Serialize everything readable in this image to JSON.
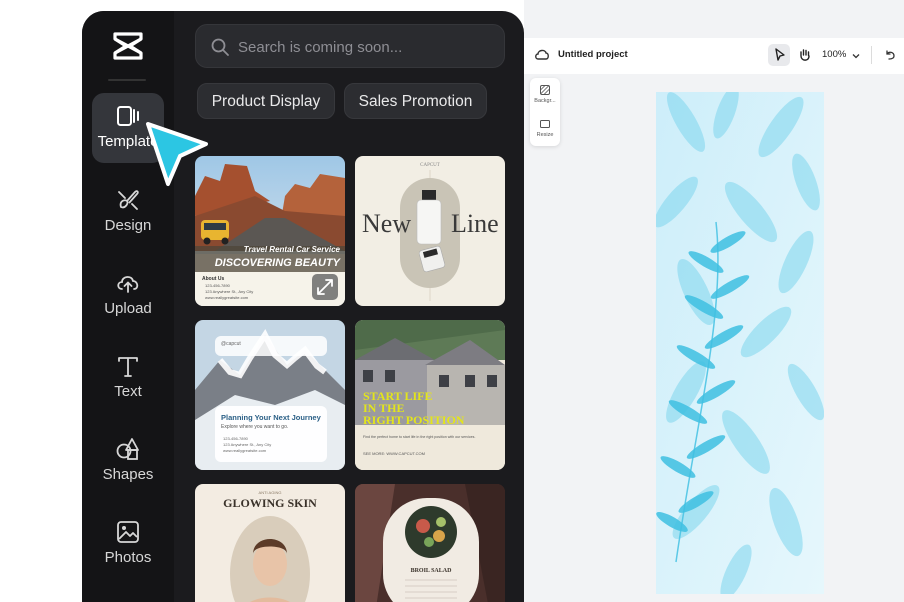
{
  "sidebar": {
    "items": [
      {
        "label": "Template",
        "icon": "template-icon",
        "active": true
      },
      {
        "label": "Design",
        "icon": "design-icon"
      },
      {
        "label": "Upload",
        "icon": "upload-icon"
      },
      {
        "label": "Text",
        "icon": "text-icon"
      },
      {
        "label": "Shapes",
        "icon": "shapes-icon"
      },
      {
        "label": "Photos",
        "icon": "photos-icon"
      }
    ]
  },
  "search": {
    "placeholder": "Search is coming soon..."
  },
  "categories": [
    "Product Display",
    "Sales Promotion"
  ],
  "templates": {
    "car": {
      "subtitle": "Travel Rental Car Service",
      "title": "DISCOVERING BEAUTY",
      "small_heading": "About Us",
      "lines": [
        "123-456-7890",
        "123 Anywhere St., Any City",
        "www.reallygreatsite.com"
      ]
    },
    "newline": {
      "brand": "CAPCUT",
      "word_left": "New",
      "word_right": "Line"
    },
    "journey": {
      "tag": "@capcut",
      "title": "Planning Your Next Journey",
      "subtitle": "Explore where you want to go.",
      "bullets": [
        "123-456-7890",
        "123 Anywhere St., Any City",
        "www.reallygreatsite.com"
      ]
    },
    "startlife": {
      "title_lines": [
        "START LIFE",
        "IN THE",
        "RIGHT POSITION"
      ],
      "body": "Find the perfect home to start life in the right position with our services.",
      "url": "SEE MORE: WWW.CAPCUT.COM"
    },
    "glowing": {
      "eyebrow": "ANTI AGING",
      "title": "GLOWING SKIN"
    },
    "salad": {
      "title": "BROIL SALAD"
    }
  },
  "editor": {
    "project_title": "Untitled project",
    "zoom": "100%",
    "side_items": [
      "Backgr...",
      "Resize"
    ]
  },
  "colors": {
    "panel": "#1b1b1e",
    "rail": "#141416",
    "accent_cursor": "#2cc6e3",
    "canvas": "#dff4fb"
  }
}
